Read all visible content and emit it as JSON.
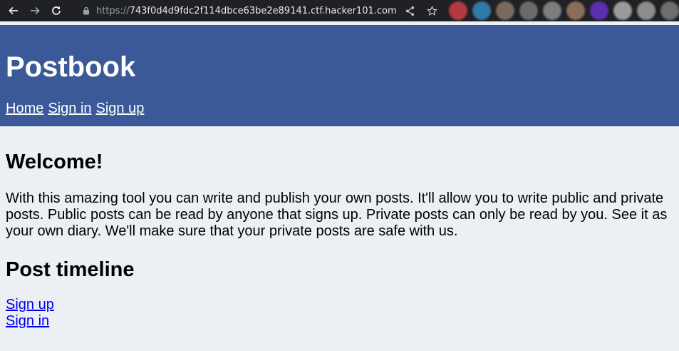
{
  "browser": {
    "url_scheme": "https://",
    "url_host": "743f0d4d9fdc2f114dbce63be2e89141.ctf.hacker101.com",
    "extension_colors": [
      "#b33a44",
      "#2f7aa8",
      "#7a6a5e",
      "#6b6b6b",
      "#7d7d7d",
      "#8a6e5a",
      "#5a2fb0",
      "#9a9a9a",
      "#8c8c8c",
      "#6e6e6e"
    ]
  },
  "header": {
    "title": "Postbook",
    "nav": [
      "Home",
      "Sign in",
      "Sign up"
    ]
  },
  "main": {
    "welcome_heading": "Welcome!",
    "intro": "With this amazing tool you can write and publish your own posts. It'll allow you to write public and private posts. Public posts can be read by anyone that signs up. Private posts can only be read by you. See it as your own diary. We'll make sure that your private posts are safe with us.",
    "timeline_heading": "Post timeline",
    "links": [
      "Sign up",
      "Sign in"
    ]
  },
  "colors": {
    "header_bg": "#3b5998",
    "page_bg": "#eceff4",
    "link": "#0000ee"
  }
}
